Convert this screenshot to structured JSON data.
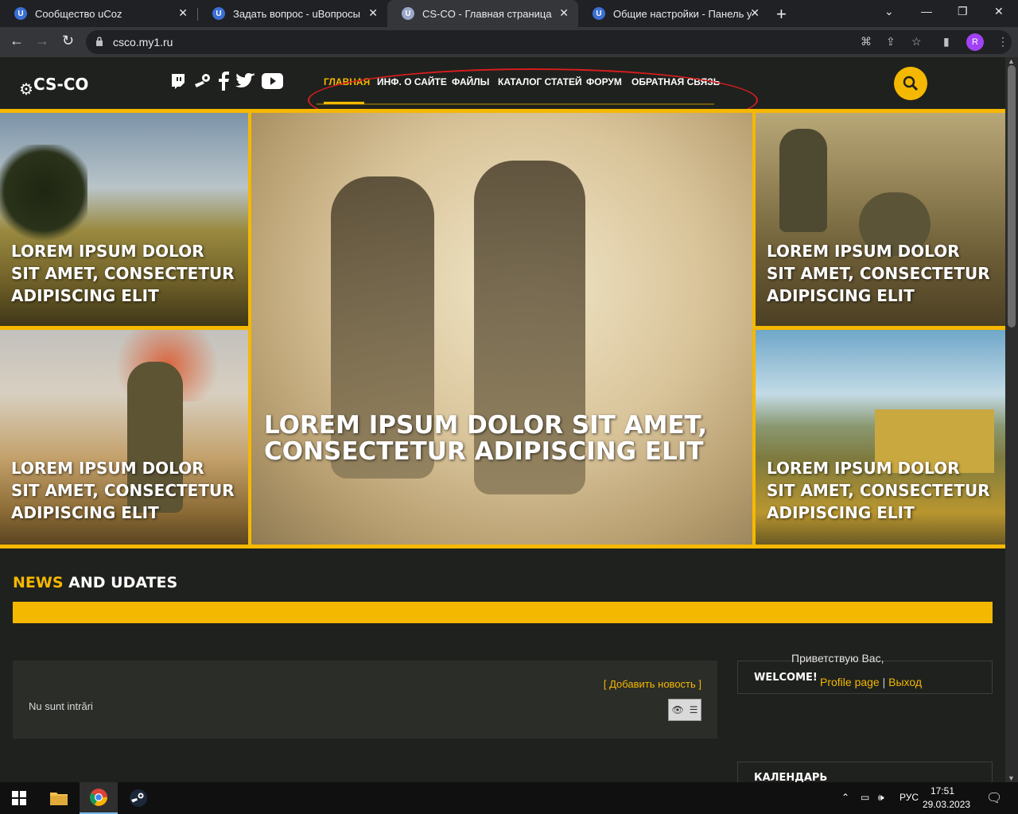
{
  "browser": {
    "tabs": [
      {
        "title": "Сообщество uCoz",
        "favicon": "U"
      },
      {
        "title": "Задать вопрос - uВопросы",
        "favicon": "U"
      },
      {
        "title": "CS-CO - Главная страница",
        "favicon": "U"
      },
      {
        "title": "Общие настройки - Панель упр",
        "favicon": "U"
      }
    ],
    "url": "csco.my1.ru",
    "profile_initial": "R"
  },
  "site": {
    "logo": "CS-CO",
    "nav": [
      "ГЛАВНАЯ",
      "ИНФ. О САЙТЕ",
      "ФАЙЛЫ",
      "КАТАЛОГ СТАТЕЙ",
      "ФОРУМ",
      "ОБРАТНАЯ СВЯЗЬ"
    ],
    "tiles": {
      "t1": "LOREM IPSUM DOLOR SIT AMET, CONSECTETUR ADIPISCING ELIT",
      "t2": "LOREM IPSUM DOLOR SIT AMET, CONSECTETUR ADIPISCING ELIT",
      "main": "LOREM IPSUM DOLOR SIT AMET, CONSECTETUR ADIPISCING ELIT",
      "t3": "LOREM IPSUM DOLOR SIT AMET, CONSECTETUR ADIPISCING ELIT",
      "t4": "LOREM IPSUM DOLOR SIT AMET, CONSECTETUR ADIPISCING ELIT"
    },
    "news": {
      "title_highlight": "NEWS",
      "title_rest": " AND UDATES",
      "add_link": "[ Добавить новость ]",
      "empty": "Nu sunt intrări"
    },
    "welcome": {
      "title": "WELCOME!",
      "greeting": "Приветствую Вас,",
      "profile_link": "Profile page",
      "divider": " | ",
      "logout_link": "Выход"
    },
    "calendar_title": "КАЛЕНДАРЬ"
  },
  "taskbar": {
    "lang": "РУС",
    "time": "17:51",
    "date": "29.03.2023"
  },
  "colors": {
    "accent": "#f5b800",
    "background": "#1f211e",
    "annotation": "#d81d1d"
  }
}
